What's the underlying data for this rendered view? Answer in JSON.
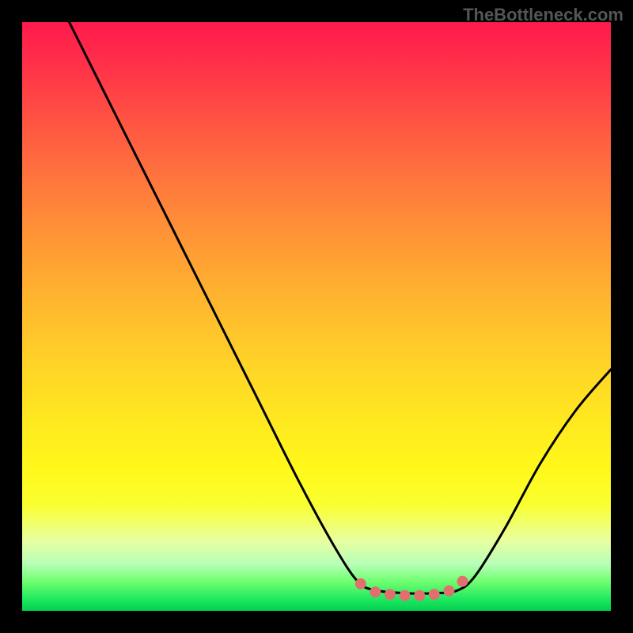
{
  "watermark": "TheBottleneck.com",
  "chart_data": {
    "type": "line",
    "title": "",
    "xlabel": "",
    "ylabel": "",
    "x_range_normalized": [
      0,
      1
    ],
    "y_range_normalized": [
      0,
      1
    ],
    "description": "Bottleneck curve: a V-shaped line on a red-to-green vertical gradient. The left branch descends steeply from a peak near x≈0.08 at top (y≈1.0) down into a flat trough between x≈0.58 and x≈0.74 near y≈0.04 (green zone). The right branch rises moderately from x≈0.74 up to roughly y≈0.40 at x=1.0.",
    "series": [
      {
        "name": "bottleneck-curve",
        "color": "#000000",
        "stroke_width": 3,
        "points_normalized": [
          [
            0.08,
            1.0
          ],
          [
            0.16,
            0.84
          ],
          [
            0.24,
            0.68
          ],
          [
            0.32,
            0.52
          ],
          [
            0.4,
            0.36
          ],
          [
            0.47,
            0.22
          ],
          [
            0.53,
            0.11
          ],
          [
            0.57,
            0.05
          ],
          [
            0.6,
            0.035
          ],
          [
            0.65,
            0.03
          ],
          [
            0.7,
            0.03
          ],
          [
            0.74,
            0.035
          ],
          [
            0.77,
            0.06
          ],
          [
            0.82,
            0.14
          ],
          [
            0.88,
            0.25
          ],
          [
            0.94,
            0.34
          ],
          [
            1.0,
            0.41
          ]
        ]
      }
    ],
    "scatter_trough": {
      "name": "trough-markers",
      "color": "#e07070",
      "radius": 7,
      "points_normalized": [
        [
          0.575,
          0.046
        ],
        [
          0.6,
          0.032
        ],
        [
          0.625,
          0.028
        ],
        [
          0.65,
          0.026
        ],
        [
          0.675,
          0.026
        ],
        [
          0.7,
          0.028
        ],
        [
          0.725,
          0.034
        ],
        [
          0.748,
          0.05
        ]
      ]
    }
  }
}
